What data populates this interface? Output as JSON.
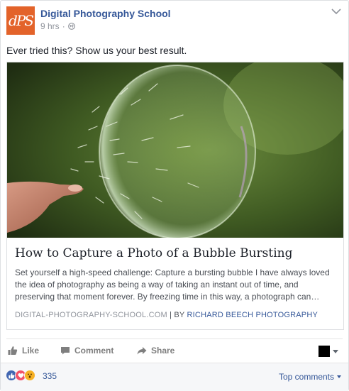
{
  "post": {
    "page_name": "Digital Photography School",
    "logo_text": "dPS",
    "time": "9 hrs",
    "separator": "·",
    "caption": "Ever tried this? Show us your best result."
  },
  "card": {
    "title": "How to Capture a Photo of a Bubble Bursting",
    "description": "Set yourself a high-speed challenge: Capture a bursting bubble I have always loved the idea of photography as being a way of taking an instant out of time, and preserving that moment forever. By freezing time in this way, a photograph can…",
    "domain": "DIGITAL-PHOTOGRAPHY-SCHOOL.COM",
    "by_label": " | BY ",
    "author": "RICHARD BEECH PHOTOGRAPHY"
  },
  "actions": {
    "like": "Like",
    "comment": "Comment",
    "share": "Share"
  },
  "reactions": {
    "count": "335",
    "sort_label": "Top comments",
    "colors": {
      "like": "#4267b2",
      "love": "#f25268",
      "wow": "#f7b125"
    }
  },
  "colors": {
    "link": "#365899",
    "brand": "#e3632a",
    "muted": "#90949c"
  }
}
